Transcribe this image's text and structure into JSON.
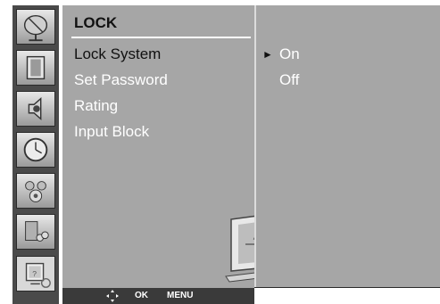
{
  "sidebar": {
    "icons": [
      {
        "name": "satellite-dish-icon"
      },
      {
        "name": "picture-icon"
      },
      {
        "name": "speaker-icon"
      },
      {
        "name": "clock-icon"
      },
      {
        "name": "gears-icon"
      },
      {
        "name": "input-source-icon"
      },
      {
        "name": "lock-icon"
      }
    ]
  },
  "menu": {
    "title": "LOCK",
    "items": [
      {
        "label": "Lock System"
      },
      {
        "label": "Set Password"
      },
      {
        "label": "Rating"
      },
      {
        "label": "Input Block"
      }
    ]
  },
  "submenu": {
    "items": [
      {
        "label": "On",
        "selected": true
      },
      {
        "label": "Off",
        "selected": false
      }
    ],
    "selected_marker": "►"
  },
  "footer": {
    "nav_icon": "navigation-arrows-icon",
    "ok_label": "OK",
    "menu_label": "MENU"
  },
  "colors": {
    "panel": "#a6a6a6",
    "sidebar": "#4a4a4a",
    "footer": "#3a3a3a",
    "text": "#ffffff",
    "title_text": "#111111"
  }
}
